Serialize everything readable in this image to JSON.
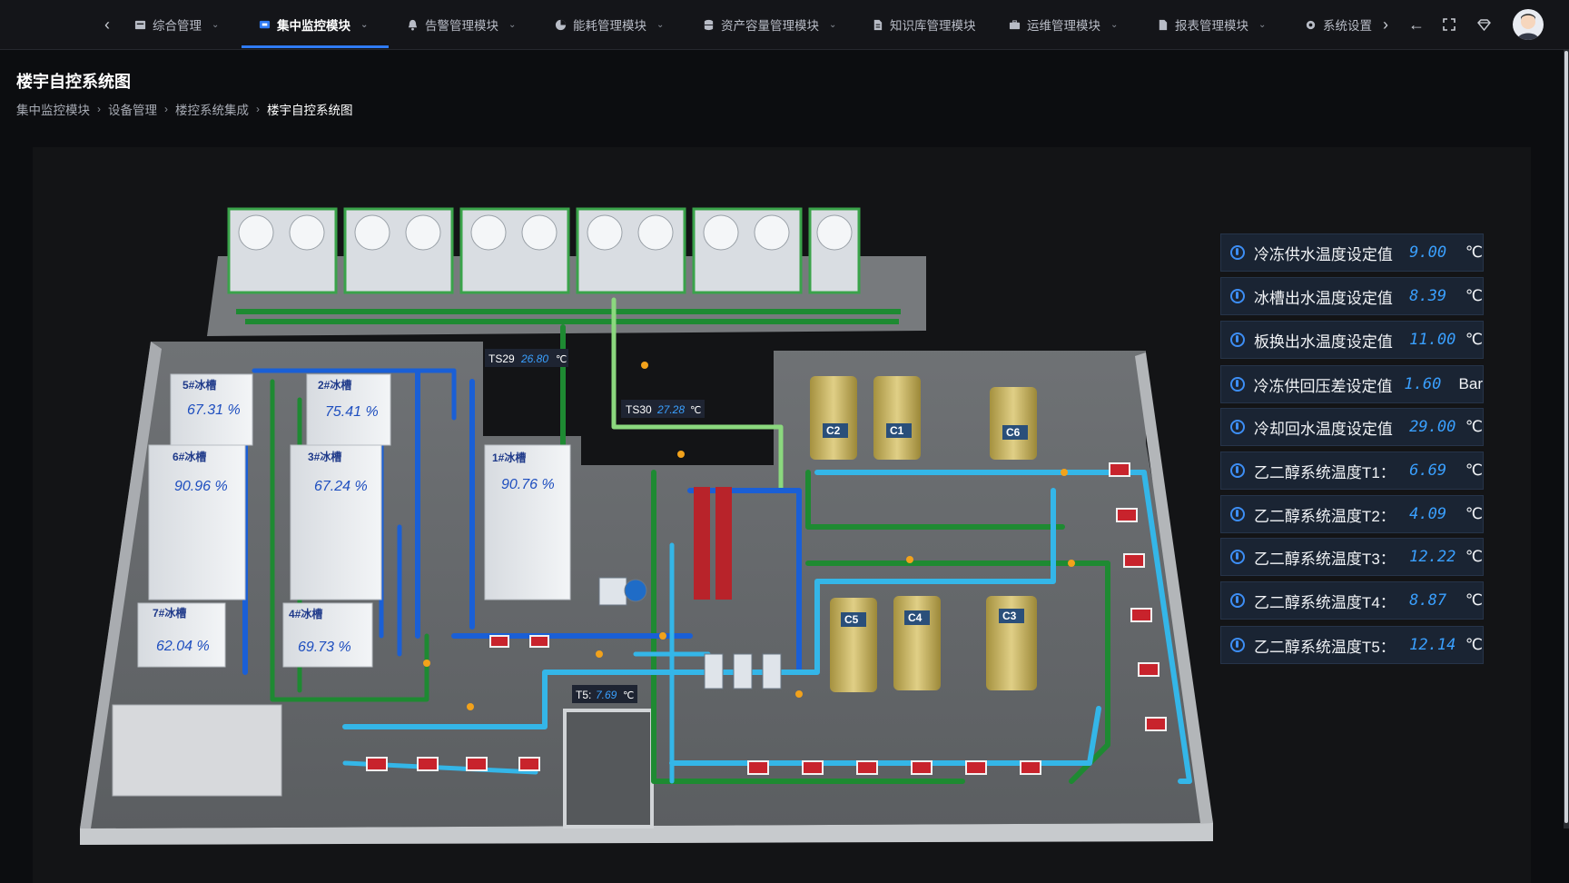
{
  "nav": {
    "items": [
      {
        "label": "综合管理",
        "icon": "dashboard-icon"
      },
      {
        "label": "集中监控模块",
        "icon": "monitor-icon"
      },
      {
        "label": "告警管理模块",
        "icon": "bell-icon"
      },
      {
        "label": "能耗管理模块",
        "icon": "pie-chart-icon"
      },
      {
        "label": "资产容量管理模块",
        "icon": "database-icon"
      },
      {
        "label": "知识库管理模块",
        "icon": "document-icon"
      },
      {
        "label": "运维管理模块",
        "icon": "toolbox-icon"
      },
      {
        "label": "报表管理模块",
        "icon": "report-icon"
      },
      {
        "label": "系统设置",
        "icon": "gear-icon"
      }
    ]
  },
  "page": {
    "title": "楼宇自控系统图",
    "breadcrumb": [
      "集中监控模块",
      "设备管理",
      "楼控系统集成",
      "楼宇自控系统图"
    ]
  },
  "diagram": {
    "tanks": [
      {
        "label": "5#冰槽",
        "value": "67.31 %"
      },
      {
        "label": "2#冰槽",
        "value": "75.41 %"
      },
      {
        "label": "6#冰槽",
        "value": "90.96 %"
      },
      {
        "label": "3#冰槽",
        "value": "67.24 %"
      },
      {
        "label": "1#冰槽",
        "value": "90.76 %"
      },
      {
        "label": "7#冰槽",
        "value": "62.04 %"
      },
      {
        "label": "4#冰槽",
        "value": "69.73 %"
      }
    ],
    "sensors": [
      {
        "label": "TS29",
        "value": "26.80",
        "unit": "℃"
      },
      {
        "label": "TS30",
        "value": "27.28",
        "unit": "℃"
      },
      {
        "label": "T5:",
        "value": "7.69",
        "unit": "℃"
      }
    ],
    "chillers": [
      "C2",
      "C1",
      "C6",
      "C5",
      "C4",
      "C3"
    ]
  },
  "settings": [
    {
      "label": "冷冻供水温度设定值",
      "value": "9.00",
      "unit": "℃"
    },
    {
      "label": "冰槽出水温度设定值",
      "value": "8.39",
      "unit": "℃"
    },
    {
      "label": "板换出水温度设定值",
      "value": "11.00",
      "unit": "℃"
    },
    {
      "label": "冷冻供回压差设定值",
      "value": "1.60",
      "unit": "Bar"
    },
    {
      "label": "冷却回水温度设定值",
      "value": "29.00",
      "unit": "℃"
    },
    {
      "label": "乙二醇系统温度T1：",
      "value": "6.69",
      "unit": "℃"
    },
    {
      "label": "乙二醇系统温度T2：",
      "value": "4.09",
      "unit": "℃"
    },
    {
      "label": "乙二醇系统温度T3：",
      "value": "12.22",
      "unit": "℃"
    },
    {
      "label": "乙二醇系统温度T4：",
      "value": "8.87",
      "unit": "℃"
    },
    {
      "label": "乙二醇系统温度T5：",
      "value": "12.14",
      "unit": "℃"
    }
  ]
}
